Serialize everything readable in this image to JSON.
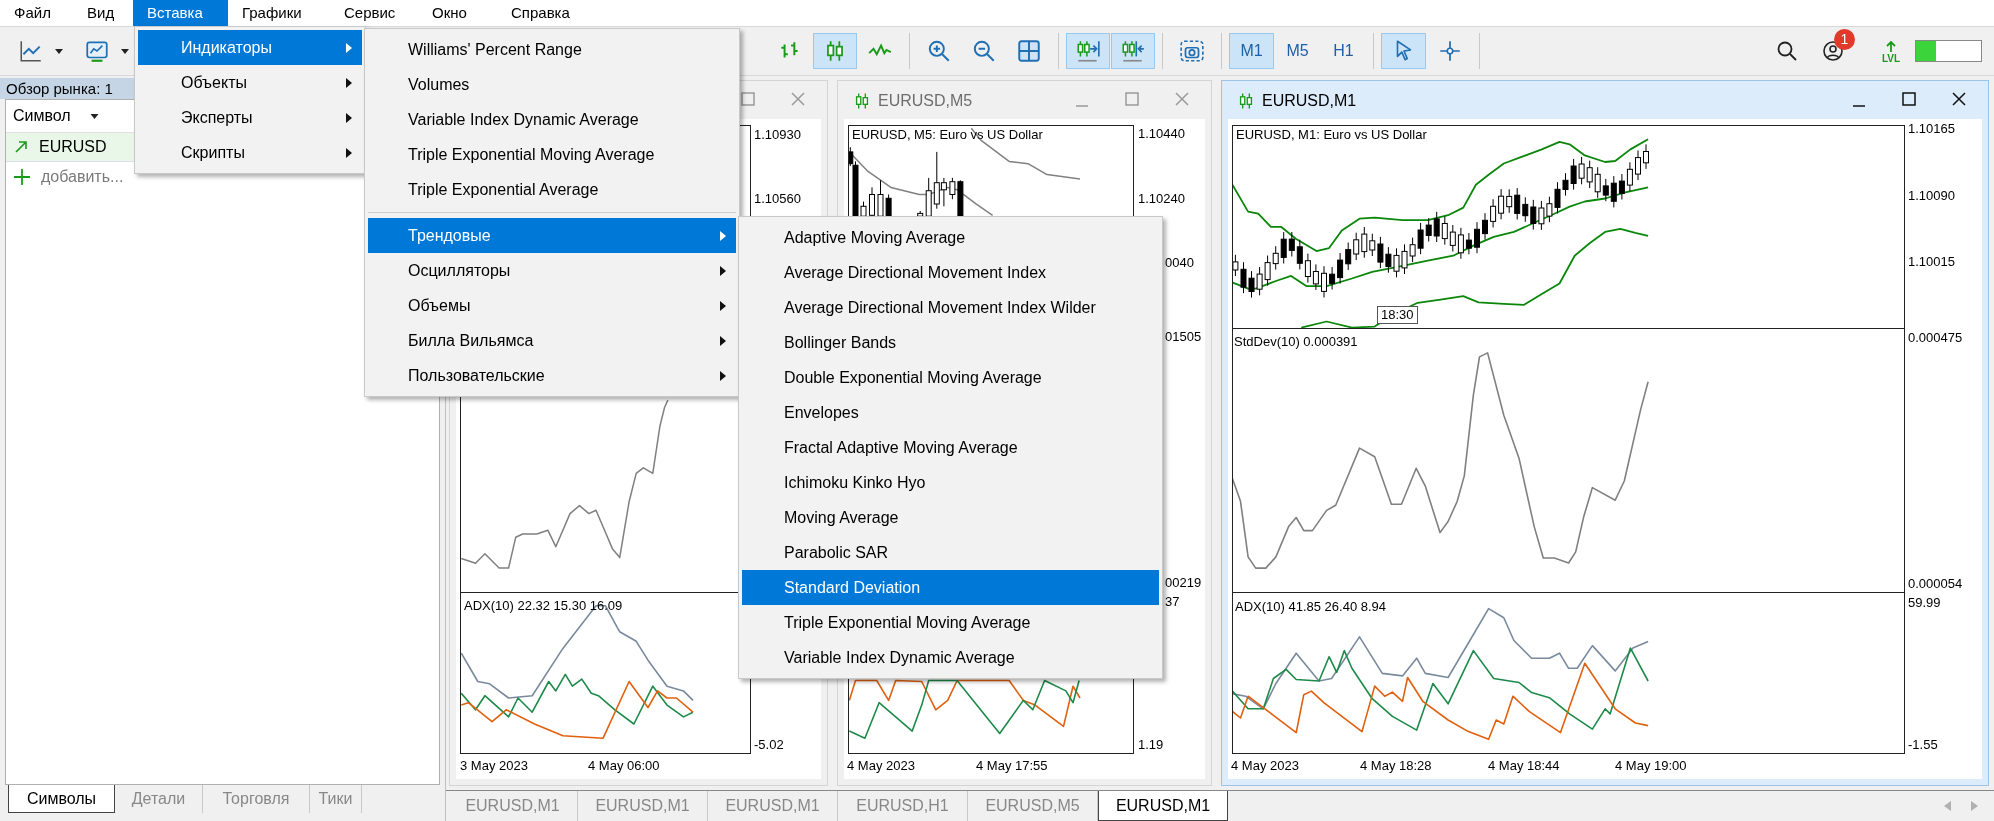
{
  "menu_bar": [
    {
      "label": "Файл",
      "selected": false
    },
    {
      "label": "Вид",
      "selected": false
    },
    {
      "label": "Вставка",
      "selected": true
    },
    {
      "label": "Графики",
      "selected": false
    },
    {
      "label": "Сервис",
      "selected": false
    },
    {
      "label": "Окно",
      "selected": false
    },
    {
      "label": "Справка",
      "selected": false
    }
  ],
  "toolbar": {
    "left_buttons": [
      {
        "selected": false
      },
      {
        "selected": false
      }
    ],
    "buttons": [
      {
        "selected": false
      },
      {
        "selected": true
      },
      {
        "selected": false
      },
      {
        "selected": false
      },
      {
        "selected": false
      },
      {
        "selected": false
      },
      {
        "selected": true
      },
      {
        "selected": true
      },
      {
        "selected": false
      }
    ],
    "timeframes": [
      {
        "label": "M1",
        "selected": true
      },
      {
        "label": "M5",
        "selected": false
      },
      {
        "label": "H1",
        "selected": false
      }
    ],
    "tools": [
      {
        "selected": true
      },
      {
        "selected": false
      }
    ],
    "notifications": "1",
    "level_label": "LVL",
    "meter": {
      "level": 0.3
    }
  },
  "market_watch": {
    "title": "Обзор рынка: 1",
    "column": "Символ",
    "symbols": [
      "EURUSD"
    ],
    "add_label": "добавить...",
    "tabs": [
      {
        "label": "Символы",
        "selected": true
      },
      {
        "label": "Детали",
        "selected": false
      },
      {
        "label": "Торговля",
        "selected": false
      },
      {
        "label": "Тики",
        "selected": false
      }
    ]
  },
  "charts": [
    {
      "active": false,
      "price_labels": [
        "1.10930",
        "1.10560"
      ],
      "adx_legend": "ADX(10) 22.32 15.30 16.09",
      "adx_labels": [
        "-5.02"
      ],
      "time_labels": [
        "3 May 2023",
        "4 May 06:00"
      ]
    },
    {
      "active": false,
      "title": "EURUSD,M5",
      "price_legend": "EURUSD, M5:  Euro vs US Dollar",
      "price_labels": [
        "1.10440",
        "1.10240",
        "0040"
      ],
      "stddev_labels": [
        "01505",
        "00219"
      ],
      "adx_labels": [
        "37",
        "1.19"
      ],
      "time_labels": [
        "4 May 2023",
        "4 May 17:55"
      ]
    },
    {
      "active": true,
      "title": "EURUSD,M1",
      "price_legend": "EURUSD, M1:  Euro vs US Dollar",
      "price_labels": [
        "1.10165",
        "1.10090",
        "1.10015"
      ],
      "time_marker": "18:30",
      "stddev_legend": "StdDev(10) 0.000391",
      "stddev_labels": [
        "0.000475",
        "0.000054"
      ],
      "adx_legend": "ADX(10) 41.85 26.40 8.94",
      "adx_labels": [
        "59.99",
        "-1.55"
      ],
      "time_labels": [
        "4 May 2023",
        "4 May 18:28",
        "4 May 18:44",
        "4 May 19:00"
      ]
    }
  ],
  "chart_tabs": [
    {
      "label": "EURUSD,M1",
      "selected": false
    },
    {
      "label": "EURUSD,M1",
      "selected": false
    },
    {
      "label": "EURUSD,M1",
      "selected": false
    },
    {
      "label": "EURUSD,H1",
      "selected": false
    },
    {
      "label": "EURUSD,M5",
      "selected": false
    },
    {
      "label": "EURUSD,M1",
      "selected": true
    }
  ],
  "menus": [
    {
      "items": [
        {
          "kind": "item",
          "label": "Индикаторы",
          "selected": true,
          "submenu": true
        },
        {
          "kind": "item",
          "label": "Объекты",
          "selected": false,
          "submenu": true
        },
        {
          "kind": "item",
          "label": "Эксперты",
          "selected": false,
          "submenu": true
        },
        {
          "kind": "item",
          "label": "Скрипты",
          "selected": false,
          "submenu": true
        }
      ]
    },
    {
      "items": [
        {
          "kind": "item",
          "label": "Williams' Percent Range",
          "selected": false,
          "submenu": false
        },
        {
          "kind": "item",
          "label": "Volumes",
          "selected": false,
          "submenu": false
        },
        {
          "kind": "item",
          "label": "Variable Index Dynamic Average",
          "selected": false,
          "submenu": false
        },
        {
          "kind": "item",
          "label": "Triple Exponential Moving Average",
          "selected": false,
          "submenu": false
        },
        {
          "kind": "item",
          "label": "Triple Exponential Average",
          "selected": false,
          "submenu": false
        },
        {
          "kind": "separator"
        },
        {
          "kind": "item",
          "label": "Трендовые",
          "selected": true,
          "submenu": true
        },
        {
          "kind": "item",
          "label": "Осцилляторы",
          "selected": false,
          "submenu": true
        },
        {
          "kind": "item",
          "label": "Объемы",
          "selected": false,
          "submenu": true
        },
        {
          "kind": "item",
          "label": "Билла Вильямса",
          "selected": false,
          "submenu": true
        },
        {
          "kind": "item",
          "label": "Пользовательские",
          "selected": false,
          "submenu": true
        }
      ]
    },
    {
      "items": [
        {
          "kind": "item",
          "label": "Adaptive Moving Average",
          "selected": false,
          "submenu": false
        },
        {
          "kind": "item",
          "label": "Average Directional Movement Index",
          "selected": false,
          "submenu": false
        },
        {
          "kind": "item",
          "label": "Average Directional Movement Index Wilder",
          "selected": false,
          "submenu": false
        },
        {
          "kind": "item",
          "label": "Bollinger Bands",
          "selected": false,
          "submenu": false
        },
        {
          "kind": "item",
          "label": "Double Exponential Moving Average",
          "selected": false,
          "submenu": false
        },
        {
          "kind": "item",
          "label": "Envelopes",
          "selected": false,
          "submenu": false
        },
        {
          "kind": "item",
          "label": "Fractal Adaptive Moving Average",
          "selected": false,
          "submenu": false
        },
        {
          "kind": "item",
          "label": "Ichimoku Kinko Hyo",
          "selected": false,
          "submenu": false
        },
        {
          "kind": "item",
          "label": "Moving Average",
          "selected": false,
          "submenu": false
        },
        {
          "kind": "item",
          "label": "Parabolic SAR",
          "selected": false,
          "submenu": false
        },
        {
          "kind": "item",
          "label": "Standard Deviation",
          "selected": true,
          "submenu": false
        },
        {
          "kind": "item",
          "label": "Triple Exponential Moving Average",
          "selected": false,
          "submenu": false
        },
        {
          "kind": "item",
          "label": "Variable Index Dynamic Average",
          "selected": false,
          "submenu": false
        }
      ]
    }
  ]
}
